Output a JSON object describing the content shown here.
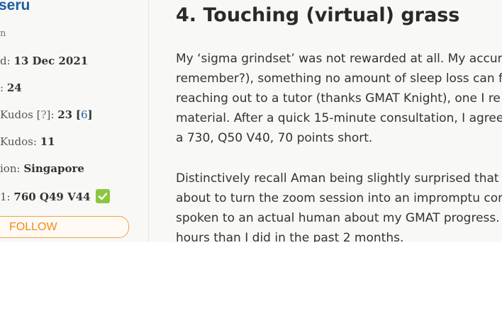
{
  "sidebar": {
    "username": "seru",
    "status": "n",
    "joined_label": "d:",
    "joined_value": "13 Dec 2021",
    "posts_label": ":",
    "posts_value": "24",
    "kudos_label": "Kudos [",
    "kudos_q": "?",
    "kudos_mid": "]:",
    "kudos_value": "23",
    "kudos_extra": "6",
    "given_label": "Kudos:",
    "given_value": "11",
    "location_label": "ion:",
    "location_value": "Singapore",
    "gmat_label": "1:",
    "gmat_value": "760 Q49 V44",
    "follow_label": "FOLLOW"
  },
  "post": {
    "heading": "4. Touching (virtual) grass",
    "paragraph1": [
      "My ‘sigma grindset’ was not rewarded at all. My accura",
      "remember?), something no amount of sleep loss can fi",
      "reaching out to a tutor (thanks GMAT Knight), one I re",
      "material. After a quick 15-minute consultation, I agreed",
      "a 730, Q50 V40, 70 points short."
    ],
    "paragraph2": [
      "Distinctively recall Aman being slightly surprised that I",
      "about to turn the zoom session into an impromptu con",
      "spoken to an actual human about my GMAT progress.",
      "hours than I did in the past 2 months."
    ]
  },
  "colors": {
    "link": "#1b5ea8",
    "verified": "#8cc63f",
    "follow": "#f08a1c"
  }
}
